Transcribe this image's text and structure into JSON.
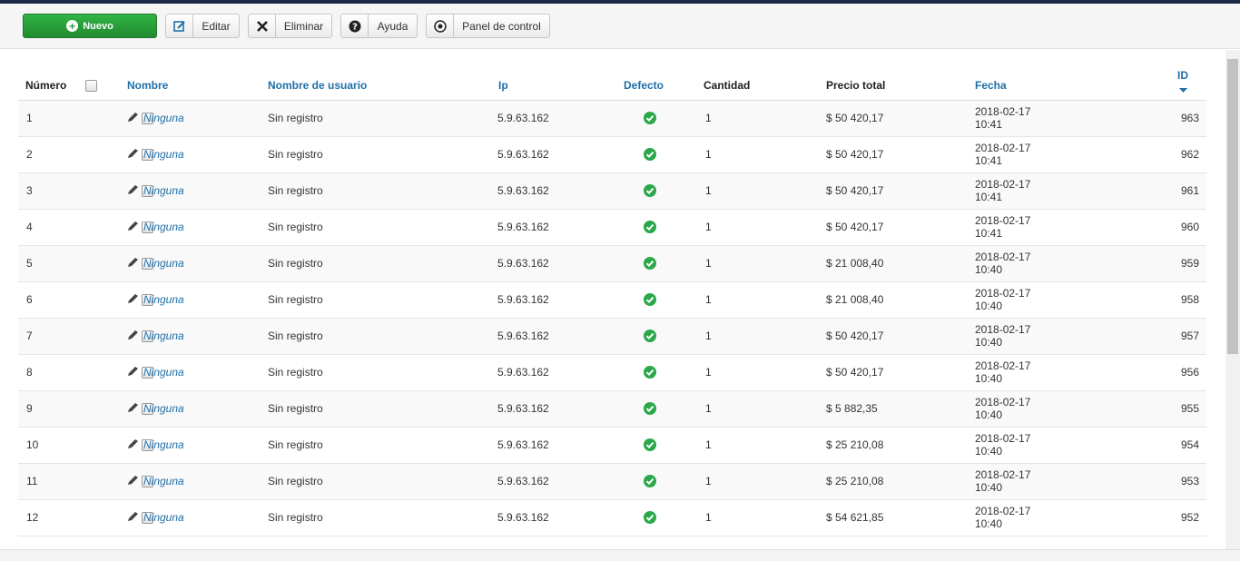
{
  "toolbar": {
    "new_label": "Nuevo",
    "edit_label": "Editar",
    "delete_label": "Eliminar",
    "help_label": "Ayuda",
    "panel_label": "Panel de control"
  },
  "table": {
    "headers": {
      "numero": "Número",
      "nombre": "Nombre",
      "usuario": "Nombre de usuario",
      "ip": "Ip",
      "defecto": "Defecto",
      "cantidad": "Cantidad",
      "precio": "Precio total",
      "fecha": "Fecha",
      "id": "ID"
    },
    "rows": [
      {
        "num": "1",
        "name": "Ninguna",
        "user": "Sin registro",
        "ip": "5.9.63.162",
        "qty": "1",
        "price": "$ 50 420,17",
        "date": "2018-02-17 10:41",
        "id": "963"
      },
      {
        "num": "2",
        "name": "Ninguna",
        "user": "Sin registro",
        "ip": "5.9.63.162",
        "qty": "1",
        "price": "$ 50 420,17",
        "date": "2018-02-17 10:41",
        "id": "962"
      },
      {
        "num": "3",
        "name": "Ninguna",
        "user": "Sin registro",
        "ip": "5.9.63.162",
        "qty": "1",
        "price": "$ 50 420,17",
        "date": "2018-02-17 10:41",
        "id": "961"
      },
      {
        "num": "4",
        "name": "Ninguna",
        "user": "Sin registro",
        "ip": "5.9.63.162",
        "qty": "1",
        "price": "$ 50 420,17",
        "date": "2018-02-17 10:41",
        "id": "960"
      },
      {
        "num": "5",
        "name": "Ninguna",
        "user": "Sin registro",
        "ip": "5.9.63.162",
        "qty": "1",
        "price": "$ 21 008,40",
        "date": "2018-02-17 10:40",
        "id": "959"
      },
      {
        "num": "6",
        "name": "Ninguna",
        "user": "Sin registro",
        "ip": "5.9.63.162",
        "qty": "1",
        "price": "$ 21 008,40",
        "date": "2018-02-17 10:40",
        "id": "958"
      },
      {
        "num": "7",
        "name": "Ninguna",
        "user": "Sin registro",
        "ip": "5.9.63.162",
        "qty": "1",
        "price": "$ 50 420,17",
        "date": "2018-02-17 10:40",
        "id": "957"
      },
      {
        "num": "8",
        "name": "Ninguna",
        "user": "Sin registro",
        "ip": "5.9.63.162",
        "qty": "1",
        "price": "$ 50 420,17",
        "date": "2018-02-17 10:40",
        "id": "956"
      },
      {
        "num": "9",
        "name": "Ninguna",
        "user": "Sin registro",
        "ip": "5.9.63.162",
        "qty": "1",
        "price": "$ 5 882,35",
        "date": "2018-02-17 10:40",
        "id": "955"
      },
      {
        "num": "10",
        "name": "Ninguna",
        "user": "Sin registro",
        "ip": "5.9.63.162",
        "qty": "1",
        "price": "$ 25 210,08",
        "date": "2018-02-17 10:40",
        "id": "954"
      },
      {
        "num": "11",
        "name": "Ninguna",
        "user": "Sin registro",
        "ip": "5.9.63.162",
        "qty": "1",
        "price": "$ 25 210,08",
        "date": "2018-02-17 10:40",
        "id": "953"
      },
      {
        "num": "12",
        "name": "Ninguna",
        "user": "Sin registro",
        "ip": "5.9.63.162",
        "qty": "1",
        "price": "$ 54 621,85",
        "date": "2018-02-17 10:40",
        "id": "952"
      }
    ]
  },
  "colors": {
    "link": "#1f6fa8",
    "success": "#2aa84a",
    "new_button": "#2a9e3a",
    "topbar": "#1a2a44"
  }
}
